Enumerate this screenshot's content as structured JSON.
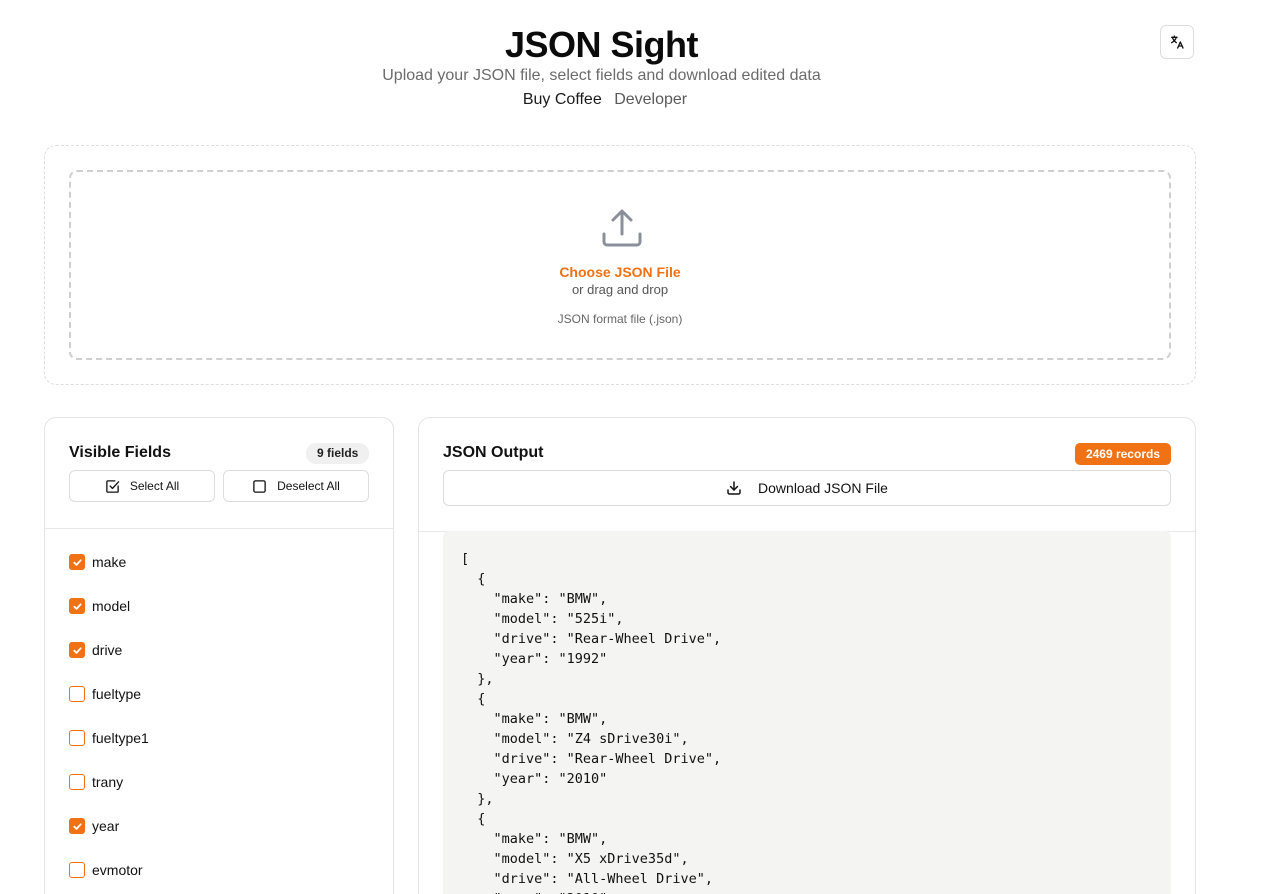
{
  "header": {
    "title": "JSON Sight",
    "subtitle": "Upload your JSON file, select fields and download edited data",
    "links": {
      "coffee": "Buy Coffee",
      "developer": "Developer"
    },
    "language_icon": "translate-icon"
  },
  "upload": {
    "icon": "upload-icon",
    "choose_label": "Choose JSON File",
    "drag_label": "or drag and drop",
    "format_label": "JSON format file (.json)",
    "accent_color": "#f07215"
  },
  "fields_panel": {
    "title": "Visible Fields",
    "count_label": "9 fields",
    "select_all": "Select All",
    "deselect_all": "Deselect All",
    "fields": [
      {
        "name": "make",
        "checked": true
      },
      {
        "name": "model",
        "checked": true
      },
      {
        "name": "drive",
        "checked": true
      },
      {
        "name": "fueltype",
        "checked": false
      },
      {
        "name": "fueltype1",
        "checked": false
      },
      {
        "name": "trany",
        "checked": false
      },
      {
        "name": "year",
        "checked": true
      },
      {
        "name": "evmotor",
        "checked": false
      }
    ]
  },
  "output_panel": {
    "title": "JSON Output",
    "records_label": "2469 records",
    "download_label": "Download JSON File",
    "json_text": "[\n  {\n    \"make\": \"BMW\",\n    \"model\": \"525i\",\n    \"drive\": \"Rear-Wheel Drive\",\n    \"year\": \"1992\"\n  },\n  {\n    \"make\": \"BMW\",\n    \"model\": \"Z4 sDrive30i\",\n    \"drive\": \"Rear-Wheel Drive\",\n    \"year\": \"2010\"\n  },\n  {\n    \"make\": \"BMW\",\n    \"model\": \"X5 xDrive35d\",\n    \"drive\": \"All-Wheel Drive\",\n    \"year\": \"2010\"\n  },"
  }
}
